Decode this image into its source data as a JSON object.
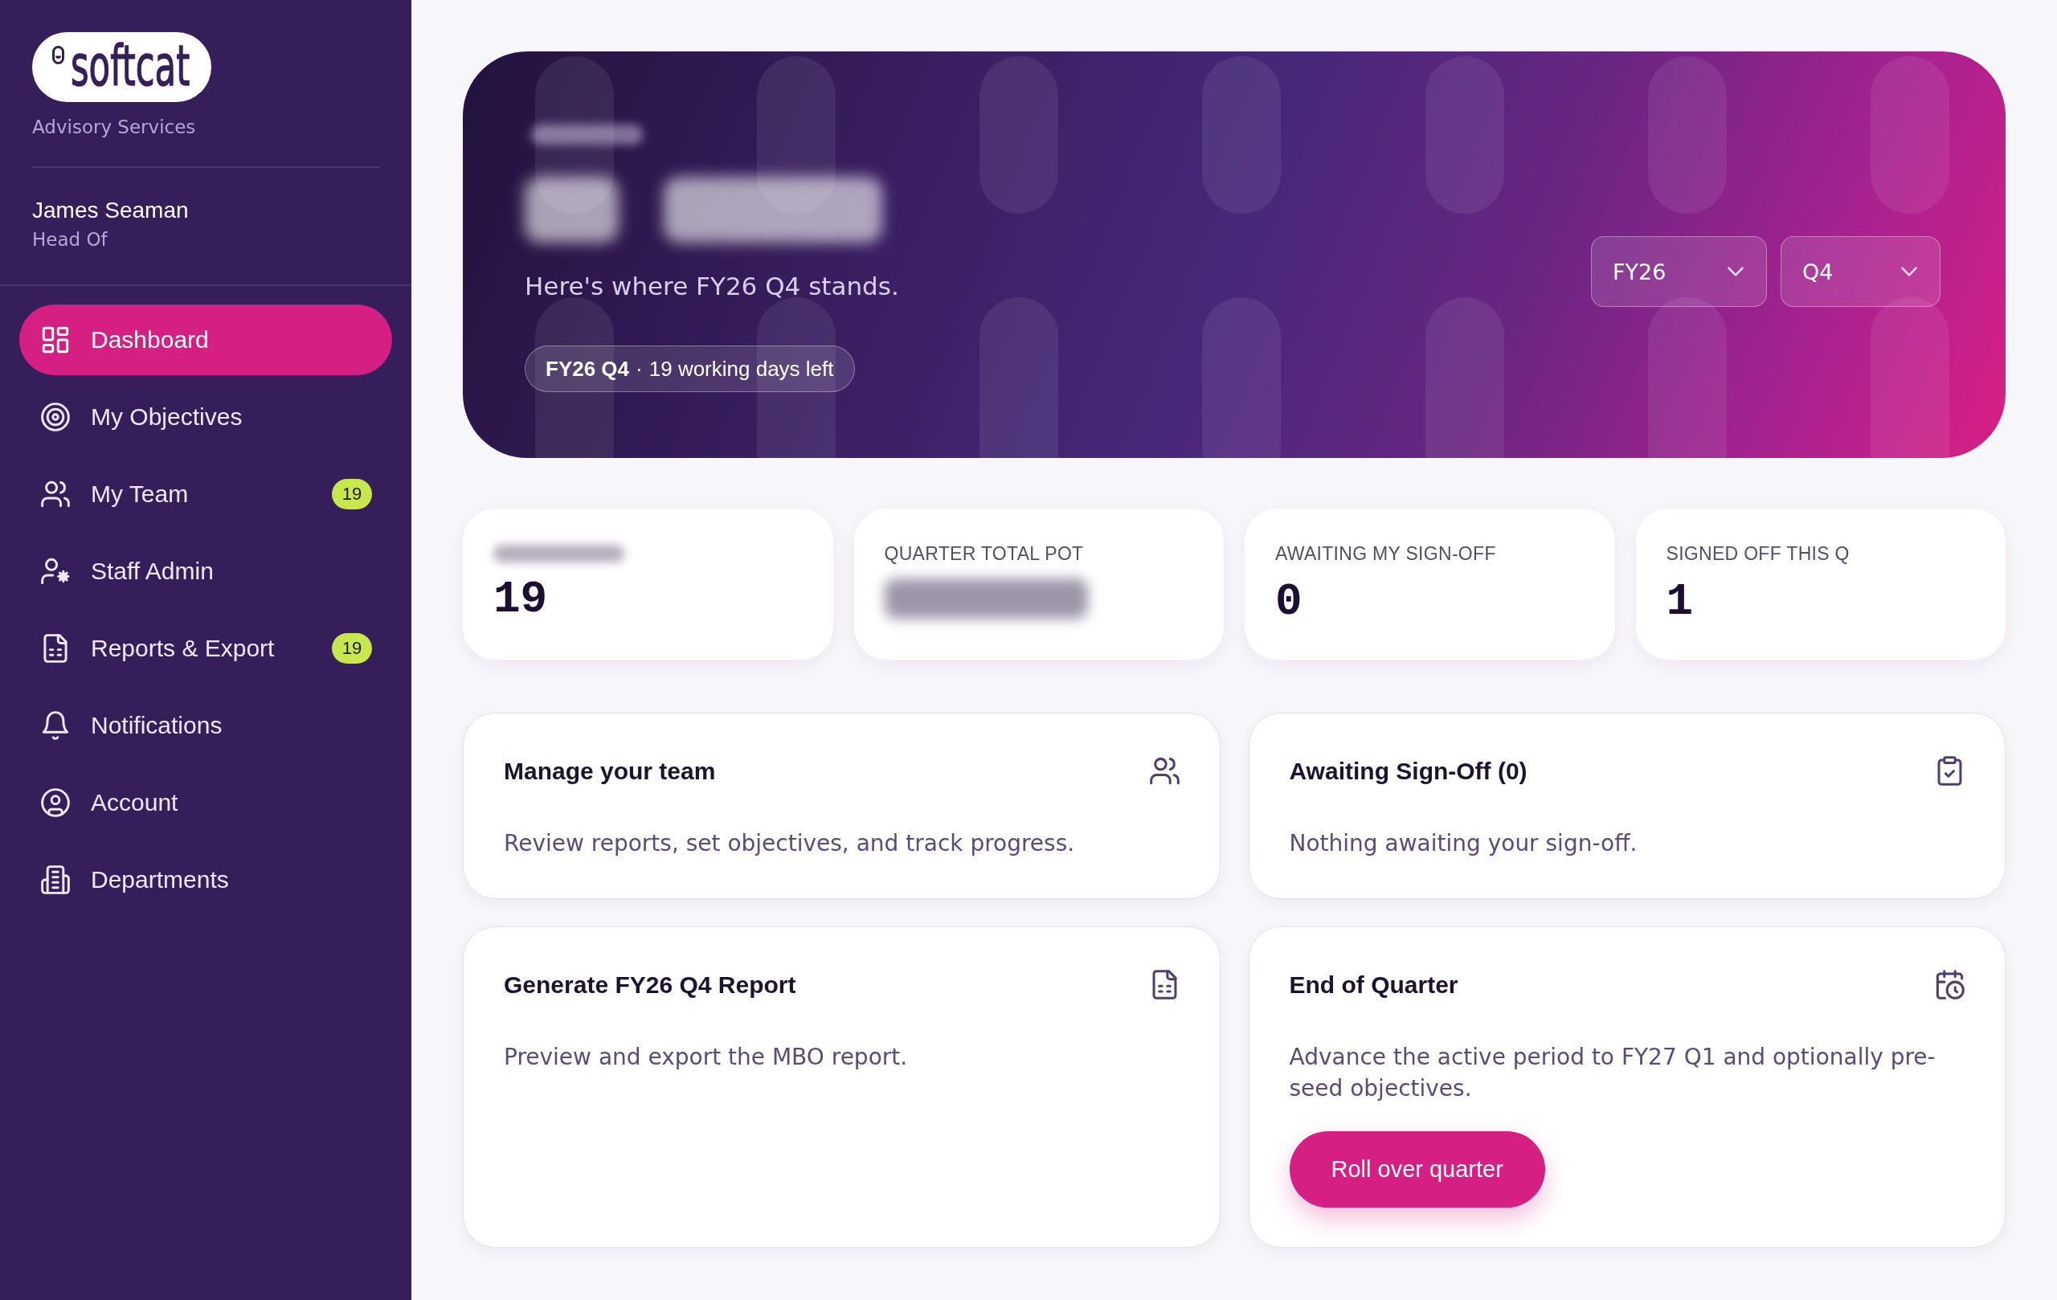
{
  "sidebar": {
    "logo": "softcat",
    "org_name": "Advisory Services",
    "user": {
      "name": "James Seaman",
      "role": "Head Of"
    },
    "nav": [
      {
        "label": "Dashboard",
        "selected": true
      },
      {
        "label": "My Objectives",
        "selected": false
      },
      {
        "label": "My Team",
        "badge": "19",
        "selected": false
      },
      {
        "label": "Staff Admin",
        "selected": false
      },
      {
        "label": "Reports & Export",
        "badge": "19",
        "selected": false
      },
      {
        "label": "Notifications",
        "selected": false
      },
      {
        "label": "Account",
        "selected": false
      },
      {
        "label": "Departments",
        "selected": false
      }
    ]
  },
  "hero": {
    "greeting_blurred": true,
    "heading_blurred": true,
    "subtitle": "Here's where FY26 Q4 stands.",
    "period_chip": {
      "period": "FY26 Q4",
      "separator": "·",
      "remaining": "19 working days left"
    },
    "selects": [
      {
        "value": "FY26"
      },
      {
        "value": "Q4"
      }
    ]
  },
  "stats": [
    {
      "label_blurred": true,
      "value": "19"
    },
    {
      "label": "QUARTER TOTAL POT",
      "value_blurred": true
    },
    {
      "label": "AWAITING MY SIGN-OFF",
      "value": "0"
    },
    {
      "label": "SIGNED OFF THIS Q",
      "value": "1"
    }
  ],
  "cards": [
    {
      "title": "Manage your team",
      "description": "Review reports, set objectives, and track progress."
    },
    {
      "title": "Awaiting Sign-Off (0)",
      "description": "Nothing awaiting your sign-off."
    },
    {
      "title": "Generate FY26 Q4 Report",
      "description": "Preview and export the MBO report."
    },
    {
      "title": "End of Quarter",
      "description": "Advance the active period to FY27 Q1 and optionally pre-seed objectives.",
      "action": "Roll over quarter"
    }
  ]
}
